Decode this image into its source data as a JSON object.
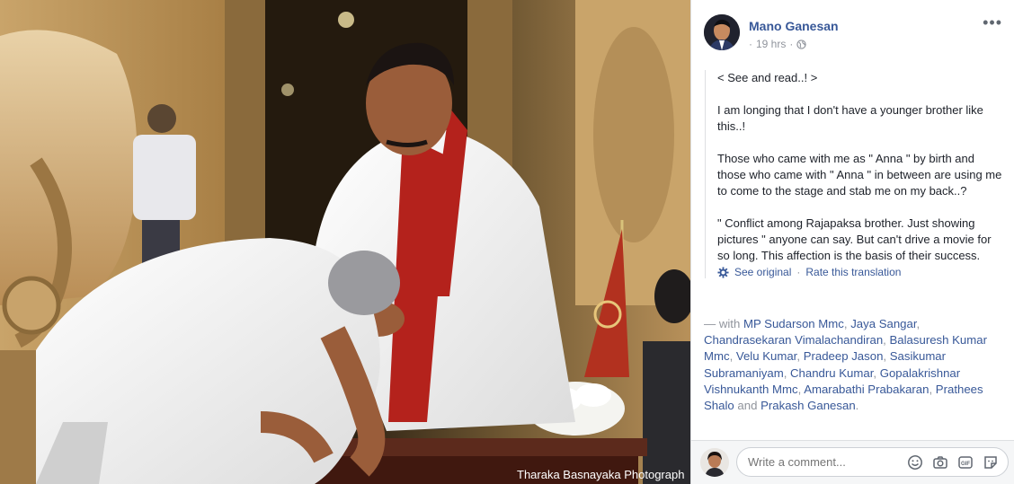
{
  "photo": {
    "watermark": "Tharaka Basnayaka Photograph"
  },
  "post": {
    "author": "Mano Ganesan",
    "time": "19 hrs",
    "time_prefix": "·",
    "more_label": "•••",
    "paragraphs": [
      "< See and read..! >",
      "I am longing that I don't have a younger brother like this..!",
      "Those who came with me as \" Anna \" by birth and those who came with \" Anna \" in between are using me to come to the stage and stab me on my back..?",
      "\" Conflict among Rajapaksa brother. Just showing pictures \" anyone can say. But can't drive a movie for so long. This affection is the basis of their success."
    ],
    "see_original": "See original",
    "separator": "·",
    "rate_translation": "Rate this translation",
    "with_prefix": "— with ",
    "tagged": [
      "MP Sudarson Mmc",
      "Jaya Sangar",
      "Chandrasekaran Vimalachandiran",
      "Balasuresh Kumar Mmc",
      "Velu Kumar",
      "Pradeep Jason",
      "Sasikumar Subramaniyam",
      "Chandru Kumar",
      "Gopalakrishnar Vishnukanth Mmc",
      "Amarabathi Prabakaran",
      "Prathees Shalo",
      "Prakash Ganesan"
    ],
    "and_word": "and",
    "trailing": "."
  },
  "comment": {
    "placeholder": "Write a comment..."
  },
  "icons": {
    "avatar": "profile-photo",
    "time": "globe-icon",
    "translate": "gear-icon",
    "comment_tools": [
      "emoji-icon",
      "camera-icon",
      "gif-icon",
      "sticker-icon"
    ]
  },
  "colors": {
    "link": "#385898",
    "meta": "#90949c",
    "text": "#1d2129",
    "border": "#dddfe2"
  }
}
